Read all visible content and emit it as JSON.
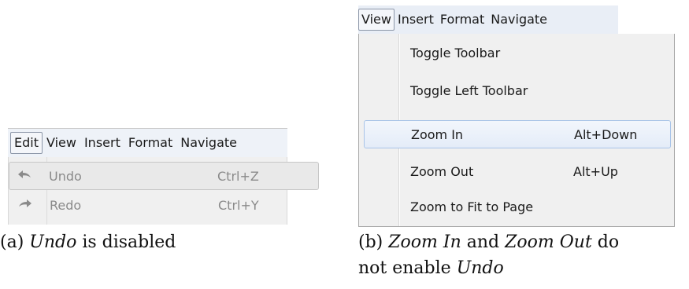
{
  "panel_a": {
    "menubar": [
      "Edit",
      "View",
      "Insert",
      "Format",
      "Navigate"
    ],
    "items": [
      {
        "icon": "undo-icon",
        "label": "Undo",
        "shortcut": "Ctrl+Z",
        "enabled": false
      },
      {
        "icon": "redo-icon",
        "label": "Redo",
        "shortcut": "Ctrl+Y",
        "enabled": false
      }
    ],
    "caption": {
      "prefix": "(a) ",
      "em": "Undo",
      "suffix": " is disabled"
    }
  },
  "panel_b": {
    "menubar": [
      "View",
      "Insert",
      "Format",
      "Navigate"
    ],
    "items": [
      {
        "label": "Toggle Toolbar",
        "shortcut": ""
      },
      {
        "label": "Toggle Left Toolbar",
        "shortcut": ""
      },
      {
        "label": "Zoom In",
        "shortcut": "Alt+Down"
      },
      {
        "label": "Zoom Out",
        "shortcut": "Alt+Up"
      },
      {
        "label": "Zoom to Fit to Page",
        "shortcut": ""
      }
    ],
    "caption": {
      "p1": "(b) ",
      "e1": "Zoom In",
      "p2": " and ",
      "e2": "Zoom Out",
      "p3": " do",
      "p4": "not enable ",
      "e3": "Undo"
    }
  }
}
